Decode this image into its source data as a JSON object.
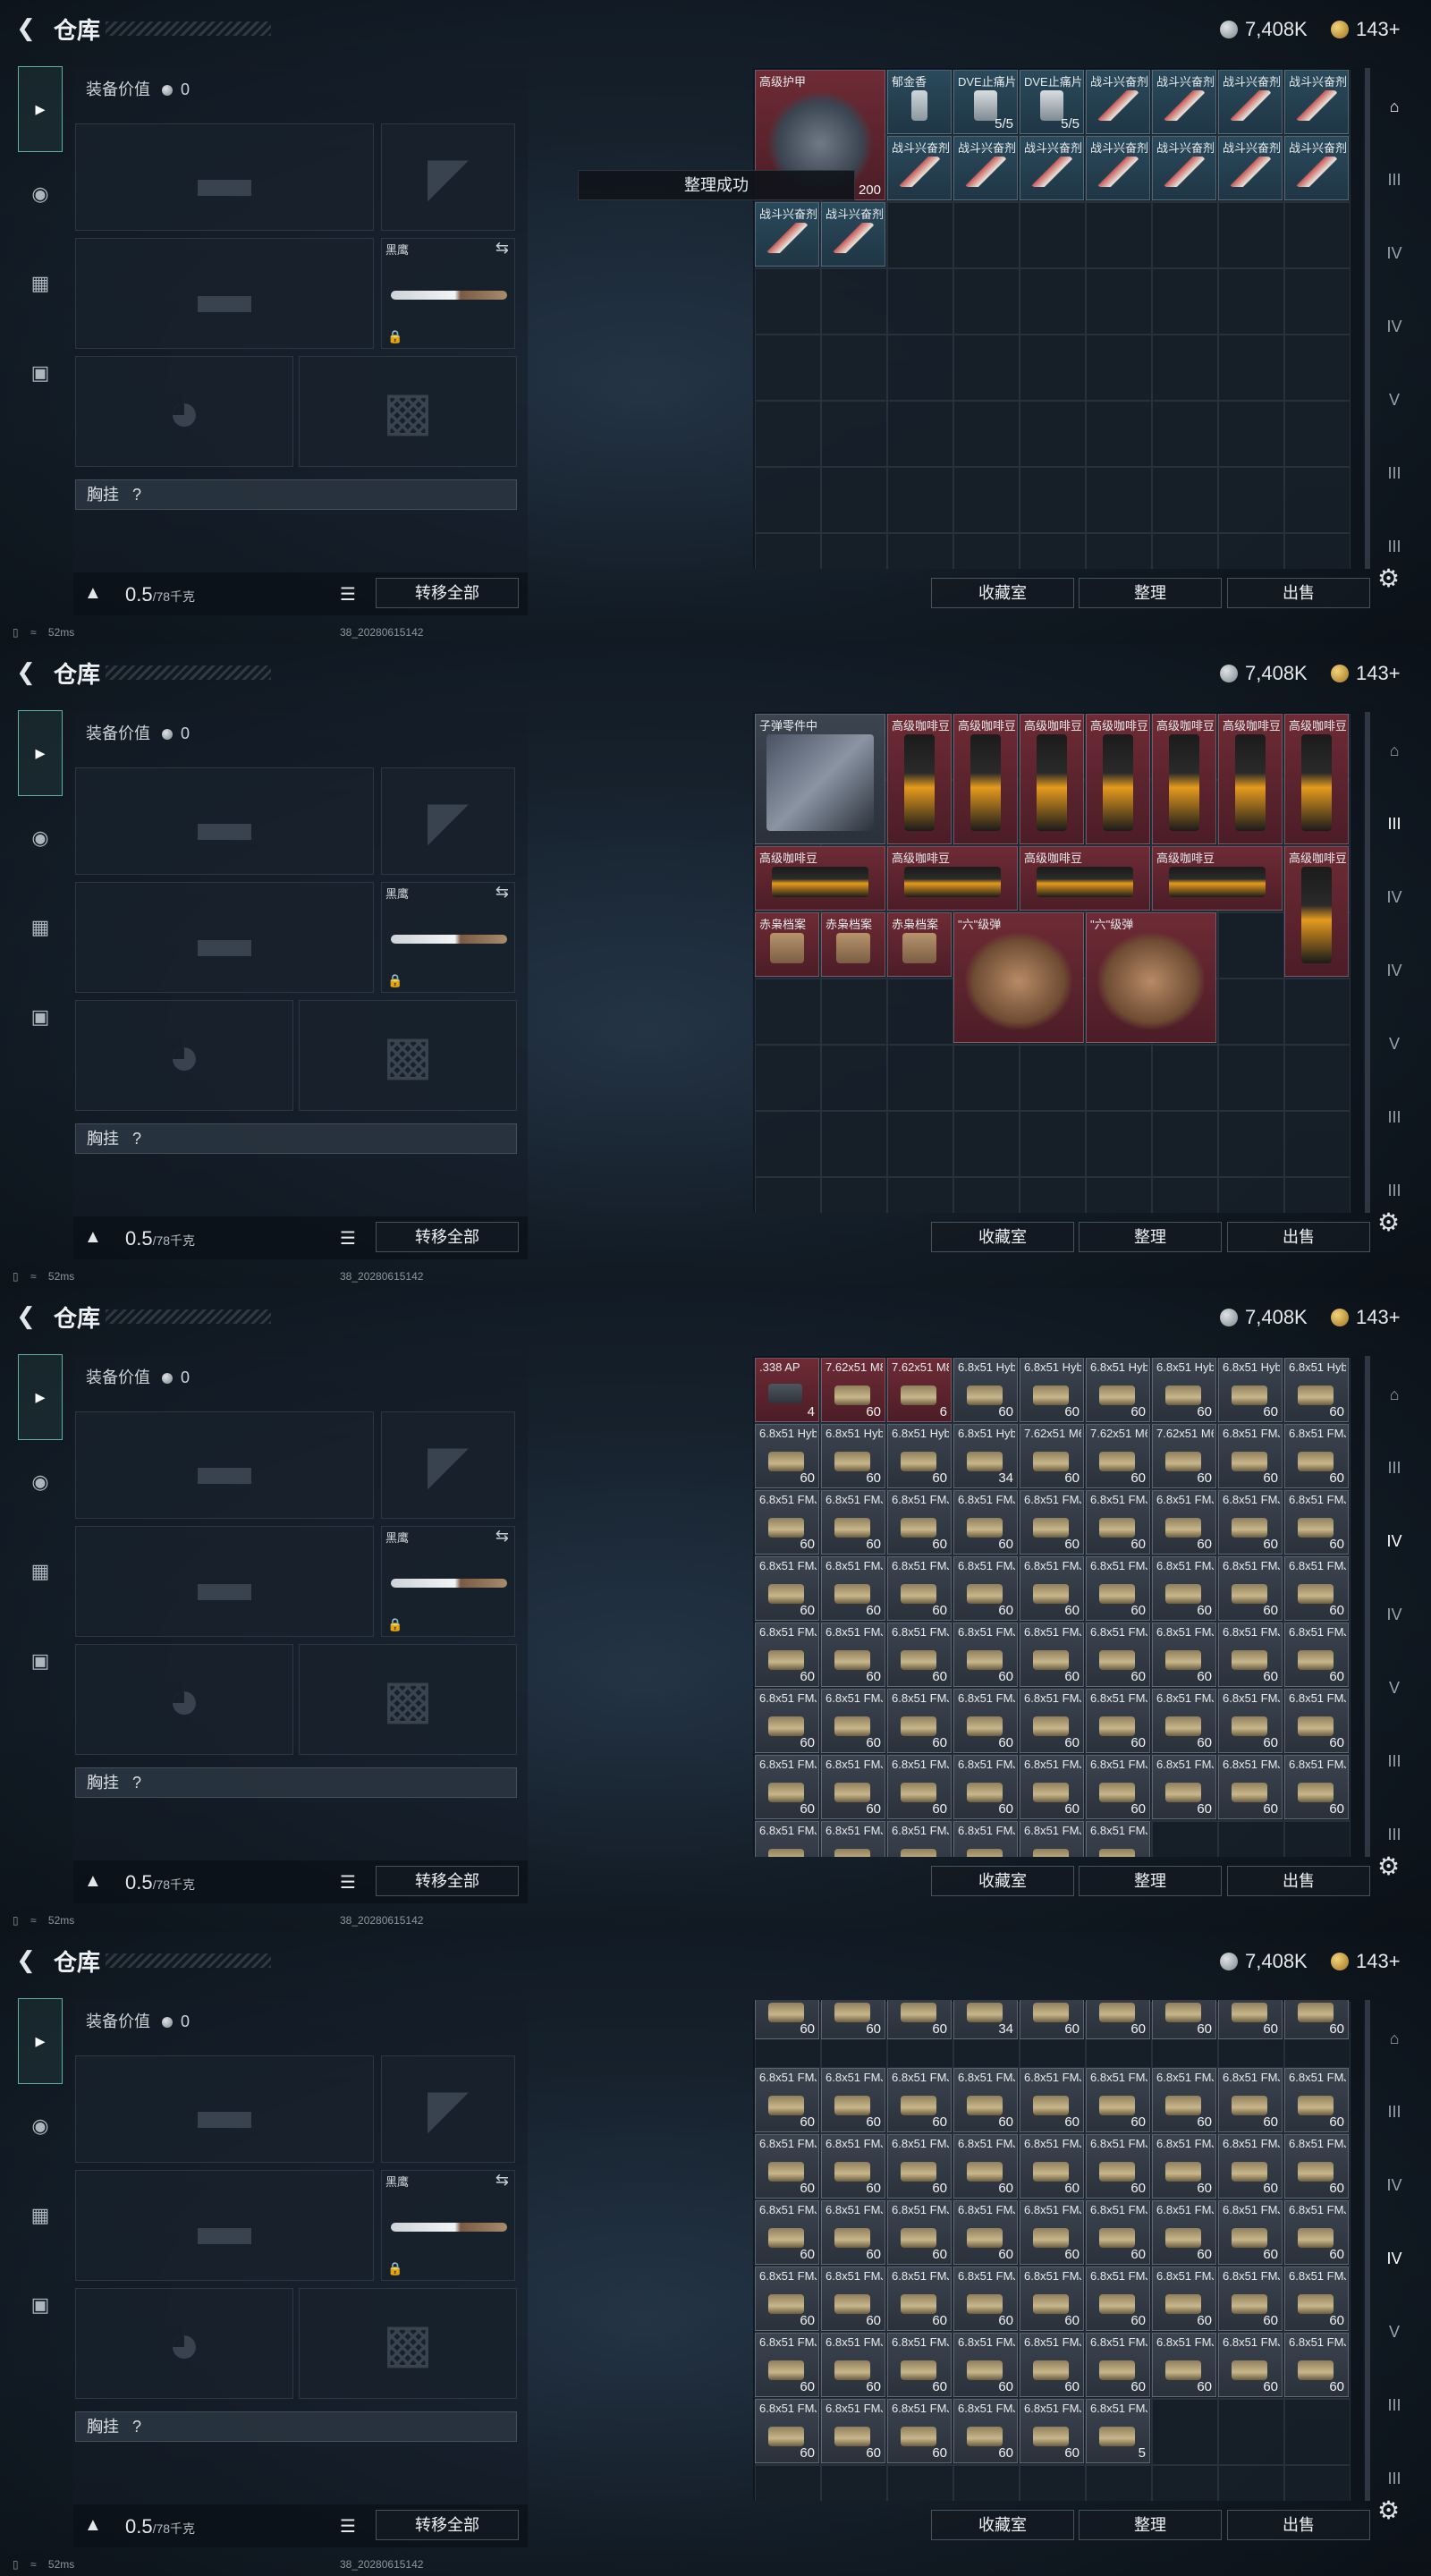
{
  "app": {
    "back_icon": "back-arrow-icon",
    "title": "仓库",
    "currency_silver": "7,408K",
    "currency_gold": "143+"
  },
  "left": {
    "equip_value_label": "装备价值",
    "equip_value": "0",
    "knife_label": "黑鹰",
    "chest_label": "胸挂",
    "chest_help": "?",
    "weight": "0.5",
    "weight_max": "/78千克",
    "transfer_all": "转移全部"
  },
  "buttons": {
    "collection": "收藏室",
    "sort": "整理",
    "sell": "出售"
  },
  "status": {
    "ping": "52ms",
    "build": "38_20280615142"
  },
  "toast": "整理成功",
  "right_tabs": [
    {
      "label": "",
      "icon": "warehouse-home-icon"
    },
    {
      "label": "III",
      "icon": "bag-iii-icon"
    },
    {
      "label": "IV",
      "icon": "bag-iv-icon"
    },
    {
      "label": "IV",
      "icon": "bag-iv-icon"
    },
    {
      "label": "V",
      "icon": "bag-v-icon"
    },
    {
      "label": "III",
      "icon": "bag-iii-icon"
    },
    {
      "label": "III",
      "icon": "bag-iii-icon"
    }
  ],
  "panels": [
    {
      "active_right_tab": 0,
      "items": [
        {
          "name": "高级护甲",
          "count": "200",
          "x": 0,
          "y": 0,
          "w": 2,
          "h": 2,
          "color": "red",
          "art": "armor"
        },
        {
          "name": "郁金香",
          "count": "",
          "x": 2,
          "y": 0,
          "w": 1,
          "h": 1,
          "color": "blue",
          "art": "bottle"
        },
        {
          "name": "DVE止痛片",
          "count": "5/5",
          "x": 3,
          "y": 0,
          "w": 1,
          "h": 1,
          "color": "blue",
          "art": "spray"
        },
        {
          "name": "DVE止痛片",
          "count": "5/5",
          "x": 4,
          "y": 0,
          "w": 1,
          "h": 1,
          "color": "blue",
          "art": "spray"
        },
        {
          "name": "战斗兴奋剂",
          "count": "",
          "x": 5,
          "y": 0,
          "w": 1,
          "h": 1,
          "color": "blue",
          "art": "stim"
        },
        {
          "name": "战斗兴奋剂",
          "count": "",
          "x": 6,
          "y": 0,
          "w": 1,
          "h": 1,
          "color": "blue",
          "art": "stim"
        },
        {
          "name": "战斗兴奋剂",
          "count": "",
          "x": 7,
          "y": 0,
          "w": 1,
          "h": 1,
          "color": "blue",
          "art": "stim"
        },
        {
          "name": "战斗兴奋剂",
          "count": "",
          "x": 8,
          "y": 0,
          "w": 1,
          "h": 1,
          "color": "blue",
          "art": "stim"
        },
        {
          "name": "战斗兴奋剂",
          "count": "",
          "x": 2,
          "y": 1,
          "w": 1,
          "h": 1,
          "color": "blue",
          "art": "stim"
        },
        {
          "name": "战斗兴奋剂",
          "count": "",
          "x": 3,
          "y": 1,
          "w": 1,
          "h": 1,
          "color": "blue",
          "art": "stim"
        },
        {
          "name": "战斗兴奋剂",
          "count": "",
          "x": 4,
          "y": 1,
          "w": 1,
          "h": 1,
          "color": "blue",
          "art": "stim"
        },
        {
          "name": "战斗兴奋剂",
          "count": "",
          "x": 5,
          "y": 1,
          "w": 1,
          "h": 1,
          "color": "blue",
          "art": "stim"
        },
        {
          "name": "战斗兴奋剂",
          "count": "",
          "x": 6,
          "y": 1,
          "w": 1,
          "h": 1,
          "color": "blue",
          "art": "stim"
        },
        {
          "name": "战斗兴奋剂",
          "count": "",
          "x": 7,
          "y": 1,
          "w": 1,
          "h": 1,
          "color": "blue",
          "art": "stim"
        },
        {
          "name": "战斗兴奋剂",
          "count": "",
          "x": 8,
          "y": 1,
          "w": 1,
          "h": 1,
          "color": "blue",
          "art": "stim"
        },
        {
          "name": "战斗兴奋剂",
          "count": "",
          "x": 0,
          "y": 2,
          "w": 1,
          "h": 1,
          "color": "blue",
          "art": "stim"
        },
        {
          "name": "战斗兴奋剂",
          "count": "",
          "x": 1,
          "y": 2,
          "w": 1,
          "h": 1,
          "color": "blue",
          "art": "stim"
        }
      ]
    },
    {
      "active_right_tab": 1,
      "items": [
        {
          "name": "子弹零件中",
          "count": "",
          "x": 0,
          "y": 0,
          "w": 2,
          "h": 2,
          "color": "gray",
          "art": "box"
        },
        {
          "name": "高级咖啡豆",
          "count": "",
          "x": 2,
          "y": 0,
          "w": 1,
          "h": 2,
          "color": "red",
          "art": "coffee"
        },
        {
          "name": "高级咖啡豆",
          "count": "",
          "x": 3,
          "y": 0,
          "w": 1,
          "h": 2,
          "color": "red",
          "art": "coffee"
        },
        {
          "name": "高级咖啡豆",
          "count": "",
          "x": 4,
          "y": 0,
          "w": 1,
          "h": 2,
          "color": "red",
          "art": "coffee"
        },
        {
          "name": "高级咖啡豆",
          "count": "",
          "x": 5,
          "y": 0,
          "w": 1,
          "h": 2,
          "color": "red",
          "art": "coffee"
        },
        {
          "name": "高级咖啡豆",
          "count": "",
          "x": 6,
          "y": 0,
          "w": 1,
          "h": 2,
          "color": "red",
          "art": "coffee"
        },
        {
          "name": "高级咖啡豆",
          "count": "",
          "x": 7,
          "y": 0,
          "w": 1,
          "h": 2,
          "color": "red",
          "art": "coffee"
        },
        {
          "name": "高级咖啡豆",
          "count": "",
          "x": 8,
          "y": 0,
          "w": 1,
          "h": 2,
          "color": "red",
          "art": "coffee"
        },
        {
          "name": "高级咖啡豆",
          "count": "",
          "x": 0,
          "y": 2,
          "w": 2,
          "h": 1,
          "color": "red",
          "art": "coffee"
        },
        {
          "name": "高级咖啡豆",
          "count": "",
          "x": 2,
          "y": 2,
          "w": 2,
          "h": 1,
          "color": "red",
          "art": "coffee"
        },
        {
          "name": "高级咖啡豆",
          "count": "",
          "x": 4,
          "y": 2,
          "w": 2,
          "h": 1,
          "color": "red",
          "art": "coffee"
        },
        {
          "name": "高级咖啡豆",
          "count": "",
          "x": 6,
          "y": 2,
          "w": 2,
          "h": 1,
          "color": "red",
          "art": "coffee"
        },
        {
          "name": "高级咖啡豆",
          "count": "",
          "x": 8,
          "y": 2,
          "w": 1,
          "h": 2,
          "color": "red",
          "art": "coffee"
        },
        {
          "name": "赤枭档案",
          "count": "",
          "x": 0,
          "y": 3,
          "w": 1,
          "h": 1,
          "color": "red",
          "art": "folder"
        },
        {
          "name": "赤枭档案",
          "count": "",
          "x": 1,
          "y": 3,
          "w": 1,
          "h": 1,
          "color": "red",
          "art": "folder"
        },
        {
          "name": "赤枭档案",
          "count": "",
          "x": 2,
          "y": 3,
          "w": 1,
          "h": 1,
          "color": "red",
          "art": "folder"
        },
        {
          "name": "\"六\"级弹",
          "count": "",
          "x": 3,
          "y": 3,
          "w": 2,
          "h": 2,
          "color": "red",
          "art": "gloves"
        },
        {
          "name": "\"六\"级弹",
          "count": "",
          "x": 5,
          "y": 3,
          "w": 2,
          "h": 2,
          "color": "red",
          "art": "gloves"
        }
      ]
    },
    {
      "active_right_tab": 2,
      "items": [
        {
          "name": ".338 AP",
          "count": "4",
          "x": 0,
          "y": 0,
          "w": 1,
          "h": 1,
          "color": "red",
          "art": "ap"
        },
        {
          "name": "7.62x51 M80",
          "count": "60",
          "x": 1,
          "y": 0,
          "w": 1,
          "h": 1,
          "color": "red",
          "art": "ammo"
        },
        {
          "name": "7.62x51 M80",
          "count": "6",
          "x": 2,
          "y": 0,
          "w": 1,
          "h": 1,
          "color": "red",
          "art": "ammo"
        },
        {
          "name": "6.8x51 Hybrid",
          "count": "60",
          "x": 3,
          "y": 0,
          "w": 1,
          "h": 1,
          "color": "gray",
          "art": "ammo"
        },
        {
          "name": "6.8x51 Hybrid",
          "count": "60",
          "x": 4,
          "y": 0,
          "w": 1,
          "h": 1,
          "color": "gray",
          "art": "ammo"
        },
        {
          "name": "6.8x51 Hybrid",
          "count": "60",
          "x": 5,
          "y": 0,
          "w": 1,
          "h": 1,
          "color": "gray",
          "art": "ammo"
        },
        {
          "name": "6.8x51 Hybrid",
          "count": "60",
          "x": 6,
          "y": 0,
          "w": 1,
          "h": 1,
          "color": "gray",
          "art": "ammo"
        },
        {
          "name": "6.8x51 Hybrid",
          "count": "60",
          "x": 7,
          "y": 0,
          "w": 1,
          "h": 1,
          "color": "gray",
          "art": "ammo"
        },
        {
          "name": "6.8x51 Hybrid",
          "count": "60",
          "x": 8,
          "y": 0,
          "w": 1,
          "h": 1,
          "color": "gray",
          "art": "ammo"
        },
        {
          "name": "6.8x51 Hybrid",
          "count": "60",
          "x": 0,
          "y": 1,
          "w": 1,
          "h": 1,
          "color": "gray",
          "art": "ammo"
        },
        {
          "name": "6.8x51 Hybrid",
          "count": "60",
          "x": 1,
          "y": 1,
          "w": 1,
          "h": 1,
          "color": "gray",
          "art": "ammo"
        },
        {
          "name": "6.8x51 Hybrid",
          "count": "60",
          "x": 2,
          "y": 1,
          "w": 1,
          "h": 1,
          "color": "gray",
          "art": "ammo"
        },
        {
          "name": "6.8x51 Hybrid",
          "count": "34",
          "x": 3,
          "y": 1,
          "w": 1,
          "h": 1,
          "color": "gray",
          "art": "ammo"
        },
        {
          "name": "7.62x51 M62",
          "count": "60",
          "x": 4,
          "y": 1,
          "w": 1,
          "h": 1,
          "color": "gray",
          "art": "ammo"
        },
        {
          "name": "7.62x51 M62",
          "count": "60",
          "x": 5,
          "y": 1,
          "w": 1,
          "h": 1,
          "color": "gray",
          "art": "ammo"
        },
        {
          "name": "7.62x51 M62",
          "count": "60",
          "x": 6,
          "y": 1,
          "w": 1,
          "h": 1,
          "color": "gray",
          "art": "ammo"
        },
        {
          "name": "6.8x51 FMJ",
          "count": "60",
          "x": 7,
          "y": 1,
          "w": 1,
          "h": 1,
          "color": "gray",
          "art": "ammo"
        },
        {
          "name": "6.8x51 FMJ",
          "count": "60",
          "x": 8,
          "y": 1,
          "w": 1,
          "h": 1,
          "color": "gray",
          "art": "ammo"
        }
      ],
      "fill": {
        "name": "6.8x51 FMJ",
        "count": "60",
        "from_row": 2,
        "to_row": 7,
        "cols": 9,
        "last_row_cols": 6,
        "color": "gray",
        "art": "ammo"
      }
    },
    {
      "active_right_tab": 3,
      "items": [
        {
          "name": "",
          "count": "60",
          "x": 0,
          "y": 0,
          "w": 1,
          "h": 1,
          "color": "gray",
          "art": "ammo",
          "partial": true
        },
        {
          "name": "",
          "count": "60",
          "x": 1,
          "y": 0,
          "w": 1,
          "h": 1,
          "color": "gray",
          "art": "ammo",
          "partial": true
        },
        {
          "name": "",
          "count": "60",
          "x": 2,
          "y": 0,
          "w": 1,
          "h": 1,
          "color": "gray",
          "art": "ammo",
          "partial": true
        },
        {
          "name": "",
          "count": "34",
          "x": 3,
          "y": 0,
          "w": 1,
          "h": 1,
          "color": "gray",
          "art": "ammo",
          "partial": true
        },
        {
          "name": "",
          "count": "60",
          "x": 4,
          "y": 0,
          "w": 1,
          "h": 1,
          "color": "gray",
          "art": "ammo",
          "partial": true
        },
        {
          "name": "",
          "count": "60",
          "x": 5,
          "y": 0,
          "w": 1,
          "h": 1,
          "color": "gray",
          "art": "ammo",
          "partial": true
        },
        {
          "name": "",
          "count": "60",
          "x": 6,
          "y": 0,
          "w": 1,
          "h": 1,
          "color": "gray",
          "art": "ammo",
          "partial": true
        },
        {
          "name": "",
          "count": "60",
          "x": 7,
          "y": 0,
          "w": 1,
          "h": 1,
          "color": "gray",
          "art": "ammo",
          "partial": true
        },
        {
          "name": "",
          "count": "60",
          "x": 8,
          "y": 0,
          "w": 1,
          "h": 1,
          "color": "gray",
          "art": "ammo",
          "partial": true
        },
        {
          "name": "6.8x51 FMJ",
          "count": "5",
          "x": 5,
          "y": 6,
          "w": 1,
          "h": 1,
          "color": "gray",
          "art": "ammo"
        }
      ],
      "fill": {
        "name": "6.8x51 FMJ",
        "count": "60",
        "from_row": 1,
        "to_row": 6,
        "cols": 9,
        "last_row_cols": 5,
        "color": "gray",
        "art": "ammo"
      }
    }
  ]
}
